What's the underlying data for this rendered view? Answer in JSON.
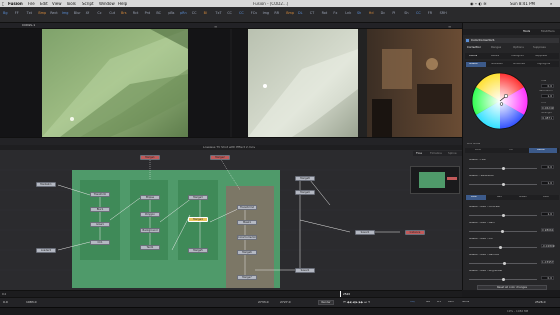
{
  "menubar": {
    "app": "Fusion",
    "items": [
      "File",
      "Edit",
      "View",
      "Tools",
      "Script",
      "Window",
      "Help"
    ],
    "doc_title": "Fusion - [COD2...]",
    "clock": "Sun 8:41 PM"
  },
  "toolbar": {
    "tools": [
      "Bg",
      "FF",
      "Txt",
      "Bmp",
      "Rect",
      "Img",
      "Blur",
      "Xf",
      "Cc",
      "Cut",
      "Brs",
      "Rct",
      "Pnt",
      "BC",
      "pBs",
      "pRn",
      "CC",
      "Bl",
      "TxT",
      "CC",
      "CC",
      "FCv",
      "Img",
      "RR",
      "Bmp",
      "DL",
      "CT",
      "Rot",
      "Fx",
      "Lnk",
      "Sh",
      "Hd",
      "Dc",
      "Pl",
      "Sh",
      "CC",
      "FR",
      "SRH"
    ],
    "colors": {
      "accent": "#5a8fd8",
      "orange": "#d98b3a"
    }
  },
  "viewers": {
    "left_tab": "COD2L.1",
    "right_tab": "",
    "left_controls": [
      "SubV",
      "Fit",
      "Snap",
      "LUT",
      "ROI",
      "DOD"
    ],
    "right_controls": [
      "SubV",
      "Fit",
      "Snap",
      "LUT",
      "ROI",
      "DOD"
    ],
    "caption": "Lossless TV Shot with Effect 2.mov",
    "merge_label": "Merge1"
  },
  "inspector": {
    "tabs": [
      "Tools",
      "Modifiers"
    ],
    "node_name": "ColorCorrector1",
    "sub_tabs": [
      "Correction",
      "Ranges",
      "Options",
      "Suppress"
    ],
    "mode_tabs": [
      "Colors",
      "Levels",
      "Histogram",
      "Suppress"
    ],
    "range_tabs": [
      "Master",
      "Shadows",
      "Midtones",
      "Highlights"
    ],
    "readouts": [
      {
        "label": "Hue",
        "value": "0.0"
      },
      {
        "label": "Saturation",
        "value": "1.0"
      },
      {
        "label": "Tint",
        "value": "0.06249"
      },
      {
        "label": "Strength",
        "value": "0.4871"
      }
    ],
    "sync_label": "Pick Mode",
    "pick_options": [
      "Pure",
      "Full",
      "Better"
    ],
    "master_hue": {
      "label": "Master - Hue",
      "value": "0.0",
      "level": 0.5
    },
    "master_sat": {
      "label": "Master - Saturation",
      "value": "1.0",
      "level": 0.5
    },
    "channel_tabs": [
      "RGB",
      "Red",
      "Green",
      "Blue"
    ],
    "rgb_contrast": {
      "label": "Master - RGB - Contrast",
      "value": "1.0",
      "level": 0.5
    },
    "rgb_gain": {
      "label": "Master - RGB - Gain",
      "value": "0.98061",
      "level": 0.49
    },
    "rgb_lift": {
      "label": "Master - RGB - Lift",
      "value": "-0.02809",
      "level": 0.46
    },
    "rgb_gamma": {
      "label": "Master - RGB - Gamma",
      "value": "1.03957",
      "level": 0.52
    },
    "rgb_brightness": {
      "label": "Master - RGB - Brightness",
      "value": "0.0",
      "level": 0.5
    },
    "reset_label": "Reset all color changes"
  },
  "node_tabs": [
    "Flow",
    "Timeline",
    "Spline"
  ],
  "nodes": {
    "labels": [
      "MediaIn1",
      "Merge1",
      "Transform",
      "Blur1",
      "Glow1",
      "CC1",
      "Ellipse",
      "Polygon",
      "Background",
      "Text1",
      "Merge2",
      "Merge3",
      "Merge4",
      "Merge5",
      "Saver1",
      "Loader2",
      "Transform2",
      "Mask1",
      "ColorCorrector1",
      "Merge6",
      "Merge7",
      "Merge8",
      "Merge9",
      "Instance"
    ],
    "group_titles": [
      "Reflection",
      "Softener",
      "Filters",
      "Stage",
      "Fx"
    ]
  },
  "ruler": {
    "start": "0.0",
    "end": "1983.0",
    "ticks": [
      "0",
      "50",
      "100",
      "150",
      "200",
      "250",
      "300",
      "350",
      "400",
      "450",
      "500",
      "550",
      "600",
      "650",
      "700",
      "750",
      "800",
      "850",
      "900",
      "950"
    ],
    "playhead": "2520"
  },
  "transport": {
    "render_label": "Render",
    "hq_label": "HiQ",
    "mb_label": "MB",
    "prx_label": "Prx",
    "aprx_label": "APrx",
    "some_label": "Some",
    "frame_a": "2733.0",
    "frame_b": "2727.0",
    "frame_end": "2526.0"
  },
  "status": {
    "left": "",
    "right": "19% - 1082 MB"
  }
}
